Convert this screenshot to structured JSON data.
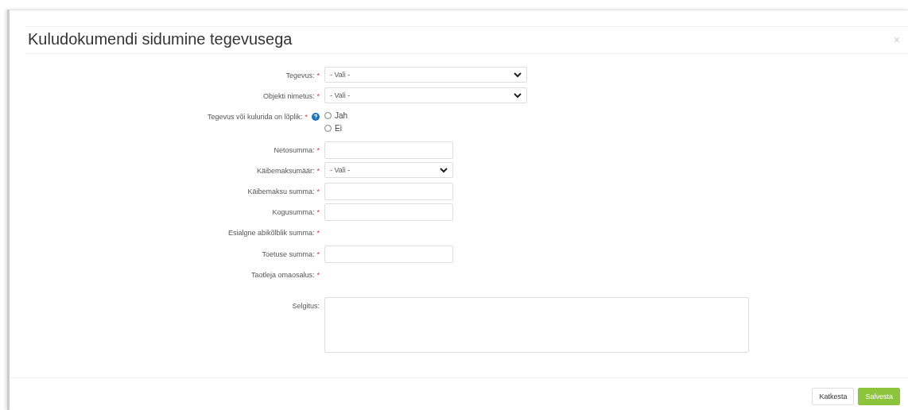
{
  "dialog": {
    "title": "Kuludokumendi sidumine tegevusega",
    "close": "×"
  },
  "fields": [
    {
      "kind": "select",
      "label": "Tegevus:",
      "required_mark": "*",
      "value": "- Vali -"
    },
    {
      "kind": "select",
      "label": "Objekti nimetus:",
      "required_mark": "*",
      "value": "- Vali -"
    },
    {
      "kind": "radio",
      "label": "Tegevus või kulurida on lõplik:",
      "required_mark": "*",
      "help": true,
      "options": [
        {
          "label": "Jah",
          "selected": false
        },
        {
          "label": "Ei",
          "selected": false
        }
      ]
    },
    {
      "kind": "input",
      "label": "Netosumma:",
      "required_mark": "*"
    },
    {
      "kind": "short-select",
      "label": "Käibemaksumäär:",
      "required_mark": "*",
      "value": "- Vali -"
    },
    {
      "kind": "input",
      "label": "Käibemaksu summa:",
      "required_mark": "*"
    },
    {
      "kind": "input",
      "label": "Kogusumma:",
      "required_mark": "*"
    },
    {
      "kind": "text",
      "label": "Esialgne abikõlblik summa:",
      "required_mark": "*"
    },
    {
      "kind": "input",
      "label": "Toetuse summa:",
      "required_mark": "*"
    },
    {
      "kind": "text",
      "label": "Taotleja omaosalus:",
      "required_mark": "*"
    },
    {
      "kind": "textarea",
      "label": "Selgitus:"
    }
  ],
  "buttons": [
    {
      "label": "Katkesta",
      "kind": "default"
    },
    {
      "label": "Salvesta",
      "kind": "primary"
    }
  ]
}
